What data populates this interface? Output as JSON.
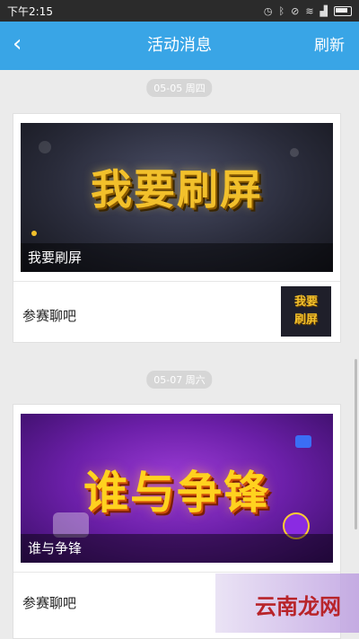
{
  "status_bar": {
    "time": "下午2:15",
    "icons": [
      "alarm-icon",
      "bluetooth-icon",
      "mute-icon",
      "wifi-icon",
      "signal-icon",
      "battery-icon"
    ]
  },
  "navbar": {
    "back_icon": "‹",
    "title": "活动消息",
    "refresh_label": "刷新"
  },
  "messages": [
    {
      "date": "05-05 周四",
      "banner_art": "我要刷屏",
      "banner_caption": "我要刷屏",
      "label": "参赛聊吧",
      "thumb_line1": "我要",
      "thumb_line2": "刷屏"
    },
    {
      "date": "05-07 周六",
      "banner_art": "谁与争锋",
      "banner_caption": "谁与争锋",
      "label": "参赛聊吧"
    }
  ],
  "watermark": {
    "text": "云南龙网"
  },
  "colors": {
    "nav": "#39a5e6",
    "background": "#ebebeb"
  }
}
